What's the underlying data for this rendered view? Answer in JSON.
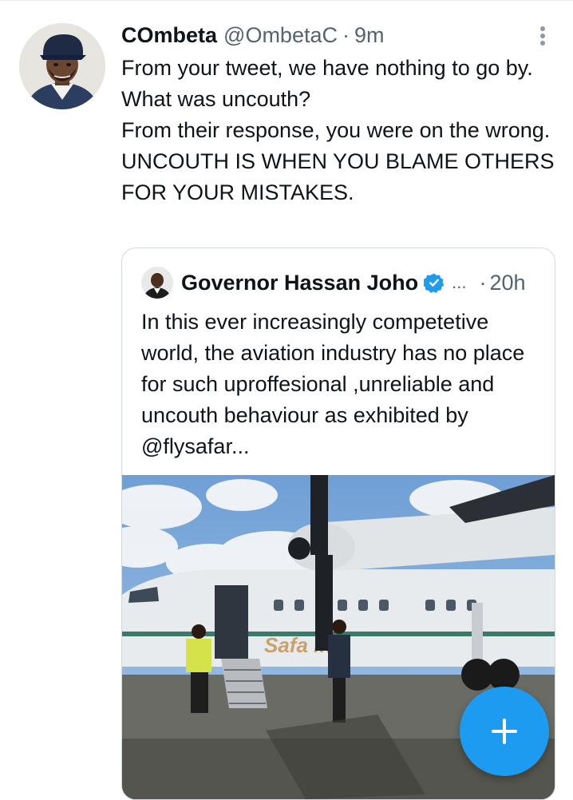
{
  "tweet": {
    "author_name": "COmbeta",
    "author_handle": "@OmbetaC",
    "separator": "·",
    "time": "9m",
    "text": "From your tweet, we have nothing to go by. What was uncouth?\nFrom their response,  you were on the wrong.\nUNCOUTH IS WHEN YOU BLAME OTHERS FOR YOUR MISTAKES.",
    "avatar_icon": "user-avatar-fbi-cap"
  },
  "quoted_tweet": {
    "author_name": "Governor Hassan Joho",
    "verified": true,
    "truncation": "...",
    "separator": "·",
    "time": "20h",
    "text": "In this ever increasingly competetive world,  the aviation industry has no place for such uproffesional ,unreliable and uncouth behaviour as exhibited by @flysafar...",
    "media": {
      "kind": "photo",
      "aircraft_livery_text": "Safa     ink"
    }
  },
  "colors": {
    "accent": "#1d9bf0",
    "text_primary": "#0f1419",
    "text_secondary": "#536471",
    "border": "#cfd9de"
  },
  "fab": {
    "icon": "plus-icon"
  },
  "more_menu": {
    "icon": "more-vertical-icon"
  }
}
